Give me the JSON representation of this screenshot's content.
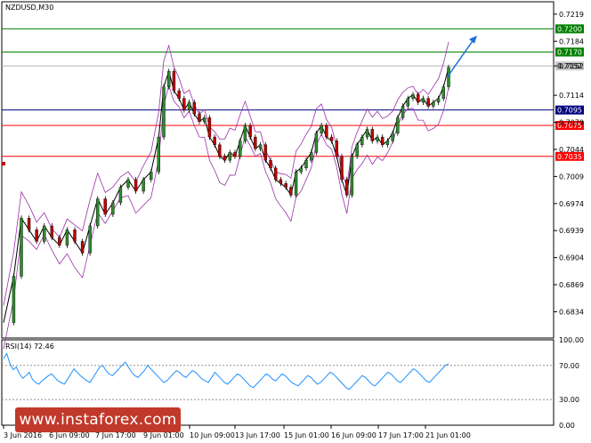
{
  "chart_data": [
    {
      "type": "candlestick",
      "title": "NZDUSD,M30",
      "ylim": [
        0.68,
        0.7235
      ],
      "y_ticks": [
        "0.7219",
        "0.7184",
        "0.7152",
        "0.7114",
        "0.7079",
        "0.7044",
        "0.7009",
        "0.6974",
        "0.6939",
        "0.6904",
        "0.6869",
        "0.6834"
      ],
      "x_ticks": [
        "3 Jun 2016",
        "6 Jun 09:00",
        "7 Jun 17:00",
        "9 Jun 01:00",
        "10 Jun 09:00",
        "13 Jun 17:00",
        "15 Jun 01:00",
        "16 Jun 09:00",
        "17 Jun 17:00",
        "21 Jun 01:00"
      ],
      "horizontal_levels": [
        {
          "value": 0.72,
          "label": "0.7200",
          "color": "#008000"
        },
        {
          "value": 0.717,
          "label": "0.7170",
          "color": "#008000"
        },
        {
          "value": 0.7152,
          "label": "0.7152",
          "color": "#b0b0b0"
        },
        {
          "value": 0.7095,
          "label": "0.7095",
          "color": "#000080"
        },
        {
          "value": 0.7075,
          "label": "0.7075",
          "color": "#ff0000"
        },
        {
          "value": 0.7035,
          "label": "0.7035",
          "color": "#ff0000"
        }
      ],
      "close_path": [
        [
          0,
          0.682
        ],
        [
          8,
          0.688
        ],
        [
          14,
          0.6955
        ],
        [
          20,
          0.694
        ],
        [
          26,
          0.6925
        ],
        [
          32,
          0.6945
        ],
        [
          38,
          0.693
        ],
        [
          44,
          0.692
        ],
        [
          50,
          0.694
        ],
        [
          56,
          0.6925
        ],
        [
          62,
          0.691
        ],
        [
          68,
          0.6945
        ],
        [
          74,
          0.698
        ],
        [
          80,
          0.696
        ],
        [
          86,
          0.6975
        ],
        [
          92,
          0.6995
        ],
        [
          98,
          0.7005
        ],
        [
          104,
          0.699
        ],
        [
          110,
          0.7005
        ],
        [
          116,
          0.7015
        ],
        [
          122,
          0.706
        ],
        [
          126,
          0.7125
        ],
        [
          130,
          0.7145
        ],
        [
          134,
          0.712
        ],
        [
          138,
          0.711
        ],
        [
          142,
          0.7095
        ],
        [
          146,
          0.7105
        ],
        [
          150,
          0.709
        ],
        [
          154,
          0.708
        ],
        [
          158,
          0.7085
        ],
        [
          162,
          0.706
        ],
        [
          166,
          0.705
        ],
        [
          170,
          0.7035
        ],
        [
          174,
          0.703
        ],
        [
          178,
          0.704
        ],
        [
          182,
          0.7035
        ],
        [
          186,
          0.7055
        ],
        [
          190,
          0.7075
        ],
        [
          194,
          0.706
        ],
        [
          198,
          0.7045
        ],
        [
          202,
          0.705
        ],
        [
          206,
          0.703
        ],
        [
          210,
          0.702
        ],
        [
          214,
          0.7005
        ],
        [
          218,
          0.7
        ],
        [
          222,
          0.6995
        ],
        [
          226,
          0.6985
        ],
        [
          230,
          0.7015
        ],
        [
          234,
          0.702
        ],
        [
          238,
          0.703
        ],
        [
          242,
          0.704
        ],
        [
          246,
          0.7065
        ],
        [
          250,
          0.7075
        ],
        [
          254,
          0.706
        ],
        [
          258,
          0.7055
        ],
        [
          262,
          0.7035
        ],
        [
          266,
          0.7005
        ],
        [
          270,
          0.6985
        ],
        [
          274,
          0.7035
        ],
        [
          278,
          0.705
        ],
        [
          282,
          0.706
        ],
        [
          286,
          0.707
        ],
        [
          290,
          0.7055
        ],
        [
          294,
          0.706
        ],
        [
          298,
          0.705
        ],
        [
          302,
          0.7055
        ],
        [
          306,
          0.7065
        ],
        [
          310,
          0.7085
        ],
        [
          314,
          0.71
        ],
        [
          318,
          0.711
        ],
        [
          322,
          0.7115
        ],
        [
          326,
          0.7105
        ],
        [
          330,
          0.711
        ],
        [
          334,
          0.71
        ],
        [
          338,
          0.7105
        ],
        [
          342,
          0.711
        ],
        [
          346,
          0.7125
        ],
        [
          350,
          0.715
        ]
      ],
      "annotation": {
        "type": "arrow",
        "direction": "up-right",
        "color": "#1a6fe0"
      }
    },
    {
      "type": "line",
      "title": "RSI(14) 72.46",
      "ylim": [
        0,
        100
      ],
      "y_ticks": [
        "100.00",
        "70.00",
        "30.00",
        "0.00"
      ],
      "levels": [
        70,
        30
      ],
      "values": [
        78,
        84,
        72,
        65,
        68,
        60,
        55,
        58,
        62,
        54,
        50,
        48,
        52,
        55,
        58,
        60,
        56,
        52,
        50,
        48,
        54,
        60,
        66,
        62,
        58,
        55,
        52,
        50,
        56,
        62,
        68,
        70,
        64,
        60,
        58,
        62,
        66,
        70,
        74,
        68,
        62,
        58,
        56,
        60,
        64,
        70,
        66,
        62,
        58,
        54,
        50,
        52,
        56,
        60,
        64,
        62,
        58,
        56,
        60,
        64,
        62,
        58,
        54,
        52,
        50,
        56,
        62,
        58,
        54,
        50,
        48,
        52,
        56,
        60,
        58,
        54,
        50,
        46,
        44,
        48,
        52,
        56,
        60,
        58,
        54,
        52,
        56,
        60,
        58,
        54,
        50,
        48,
        46,
        50,
        54,
        58,
        56,
        52,
        48,
        50,
        54,
        58,
        62,
        60,
        56,
        52,
        48,
        44,
        42,
        46,
        50,
        54,
        58,
        56,
        52,
        48,
        46,
        50,
        54,
        58,
        62,
        60,
        56,
        52,
        50,
        54,
        58,
        62,
        66,
        64,
        60,
        56,
        52,
        50,
        54,
        58,
        62,
        66,
        70,
        72
      ]
    }
  ],
  "watermark": {
    "text": "www.instaforex.com"
  }
}
